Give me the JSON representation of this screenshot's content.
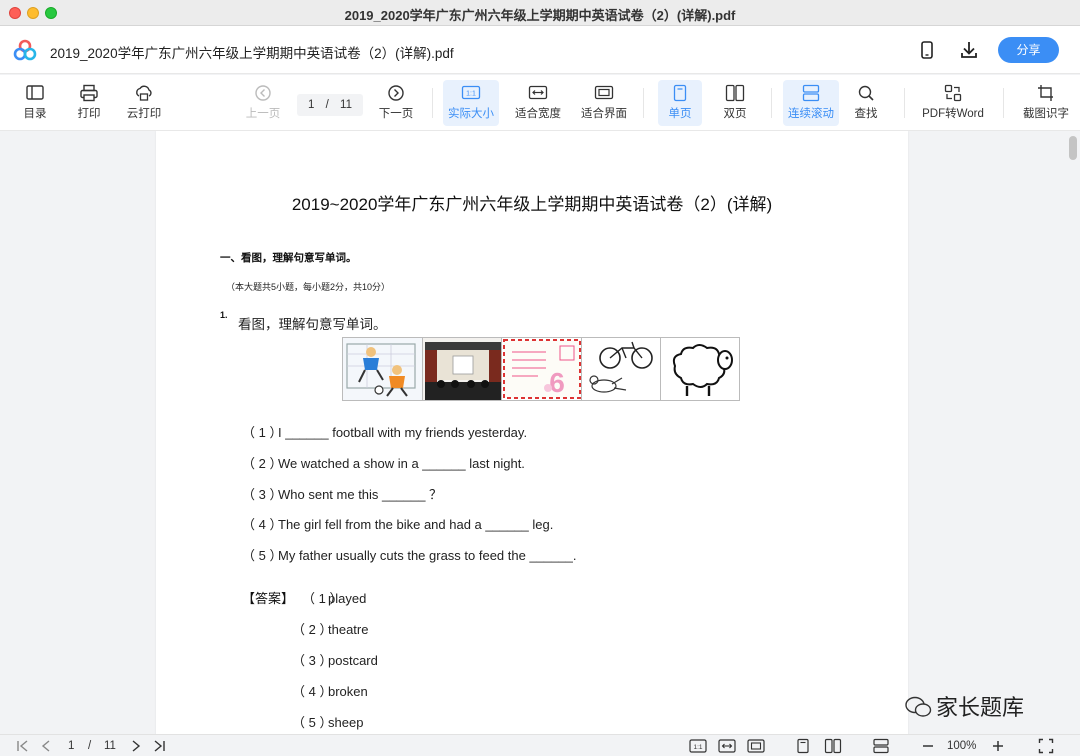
{
  "window": {
    "title": "2019_2020学年广东广州六年级上学期期中英语试卷（2）(详解).pdf"
  },
  "header": {
    "doc_title": "2019_2020学年广东广州六年级上学期期中英语试卷（2）(详解).pdf",
    "share_label": "分享",
    "accent": "#3b8ef5"
  },
  "toolbar": {
    "toc": "目录",
    "print": "打印",
    "cloud_print": "云打印",
    "prev_page": "上一页",
    "page_current": "1",
    "page_sep": "/",
    "page_total": "11",
    "next_page": "下一页",
    "actual_size": "实际大小",
    "fit_width": "适合宽度",
    "fit_page": "适合界面",
    "single_page": "单页",
    "double_page": "双页",
    "continuous_scroll": "连续滚动",
    "find": "查找",
    "pdf_to_word": "PDF转Word",
    "ocr": "截图识字",
    "actual_size_icon_text": "1:1"
  },
  "page": {
    "title": "2019~2020学年广东广州六年级上学期期中英语试卷（2）(详解)",
    "section": "一、看图，理解句意写单词。",
    "note": "（本大题共5小题，每小题2分，共10分）",
    "question_number": "1.",
    "question_text": "看图，理解句意写单词。",
    "pictures": [
      "soccer",
      "theatre",
      "postcard",
      "bicycle-crash",
      "sheep"
    ],
    "items": [
      {
        "num": "（ 1 ）",
        "text": "I ______ football with my friends yesterday."
      },
      {
        "num": "（ 2 ）",
        "text": "We watched a show in a ______ last night."
      },
      {
        "num": "（ 3 ）",
        "text": "Who sent me this ______ ？"
      },
      {
        "num": "（ 4 ）",
        "text": "The girl fell from the bike and had a ______ leg."
      },
      {
        "num": "（ 5 ）",
        "text": "My father usually cuts the grass to feed the ______."
      }
    ],
    "answer_label": "【答案】",
    "answers": [
      {
        "num": "（ 1 ）",
        "text": "played"
      },
      {
        "num": "（ 2 ）",
        "text": "theatre"
      },
      {
        "num": "（ 3 ）",
        "text": "postcard"
      },
      {
        "num": "（ 4 ）",
        "text": "broken"
      },
      {
        "num": "（ 5 ）",
        "text": "sheep"
      }
    ]
  },
  "statusbar": {
    "page_current": "1",
    "page_sep": "/",
    "page_total": "11",
    "zoom": "100%",
    "actual_size_icon_text": "1:1"
  },
  "watermark": "家长题库"
}
